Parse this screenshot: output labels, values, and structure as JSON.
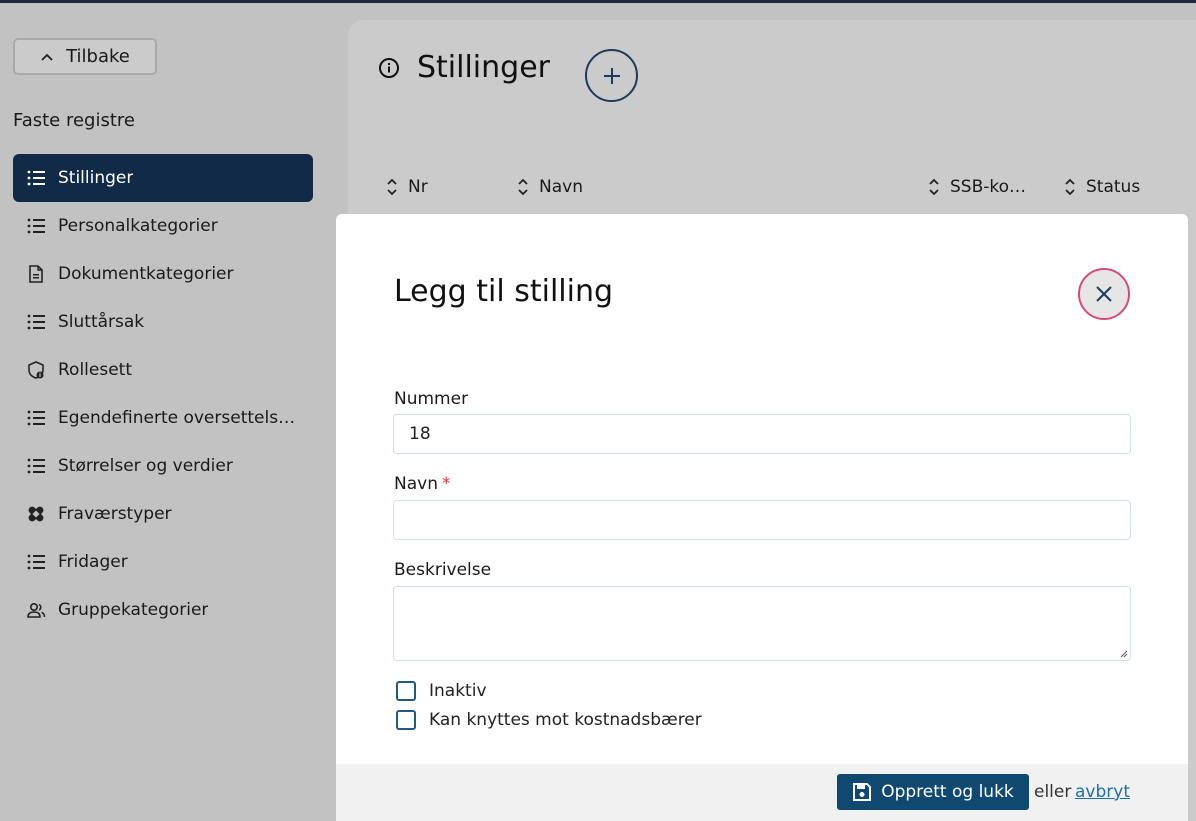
{
  "colors": {
    "sidebar_active": "#112a47",
    "primary_button": "#0f4870",
    "close_border": "#d94a78",
    "required": "#e03131",
    "link": "#1f6fa8"
  },
  "sidebar": {
    "back_label": "Tilbake",
    "section_title": "Faste registre",
    "items": [
      {
        "label": "Stillinger",
        "icon": "list-icon",
        "active": true
      },
      {
        "label": "Personalkategorier",
        "icon": "list-icon"
      },
      {
        "label": "Dokumentkategorier",
        "icon": "document-icon"
      },
      {
        "label": "Sluttårsak",
        "icon": "list-icon"
      },
      {
        "label": "Rollesett",
        "icon": "shield-info-icon"
      },
      {
        "label": "Egendefinerte oversettels…",
        "icon": "list-icon"
      },
      {
        "label": "Størrelser og verdier",
        "icon": "list-icon"
      },
      {
        "label": "Fraværstyper",
        "icon": "bandage-icon"
      },
      {
        "label": "Fridager",
        "icon": "list-icon"
      },
      {
        "label": "Gruppekategorier",
        "icon": "group-icon"
      }
    ]
  },
  "main": {
    "title": "Stillinger",
    "columns": [
      {
        "label": "Nr"
      },
      {
        "label": "Navn"
      },
      {
        "label": "SSB-ko…"
      },
      {
        "label": "Status"
      }
    ]
  },
  "modal": {
    "title": "Legg til stilling",
    "fields": {
      "nummer": {
        "label": "Nummer",
        "value": "18"
      },
      "navn": {
        "label": "Navn",
        "required_mark": "*",
        "value": ""
      },
      "beskrivelse": {
        "label": "Beskrivelse",
        "value": ""
      }
    },
    "checkboxes": [
      {
        "label": "Inaktiv",
        "checked": false
      },
      {
        "label": "Kan knyttes mot kostnadsbærer",
        "checked": false
      }
    ],
    "footer": {
      "submit_label": "Opprett og lukk",
      "or_text": "eller",
      "cancel_label": "avbryt"
    }
  }
}
